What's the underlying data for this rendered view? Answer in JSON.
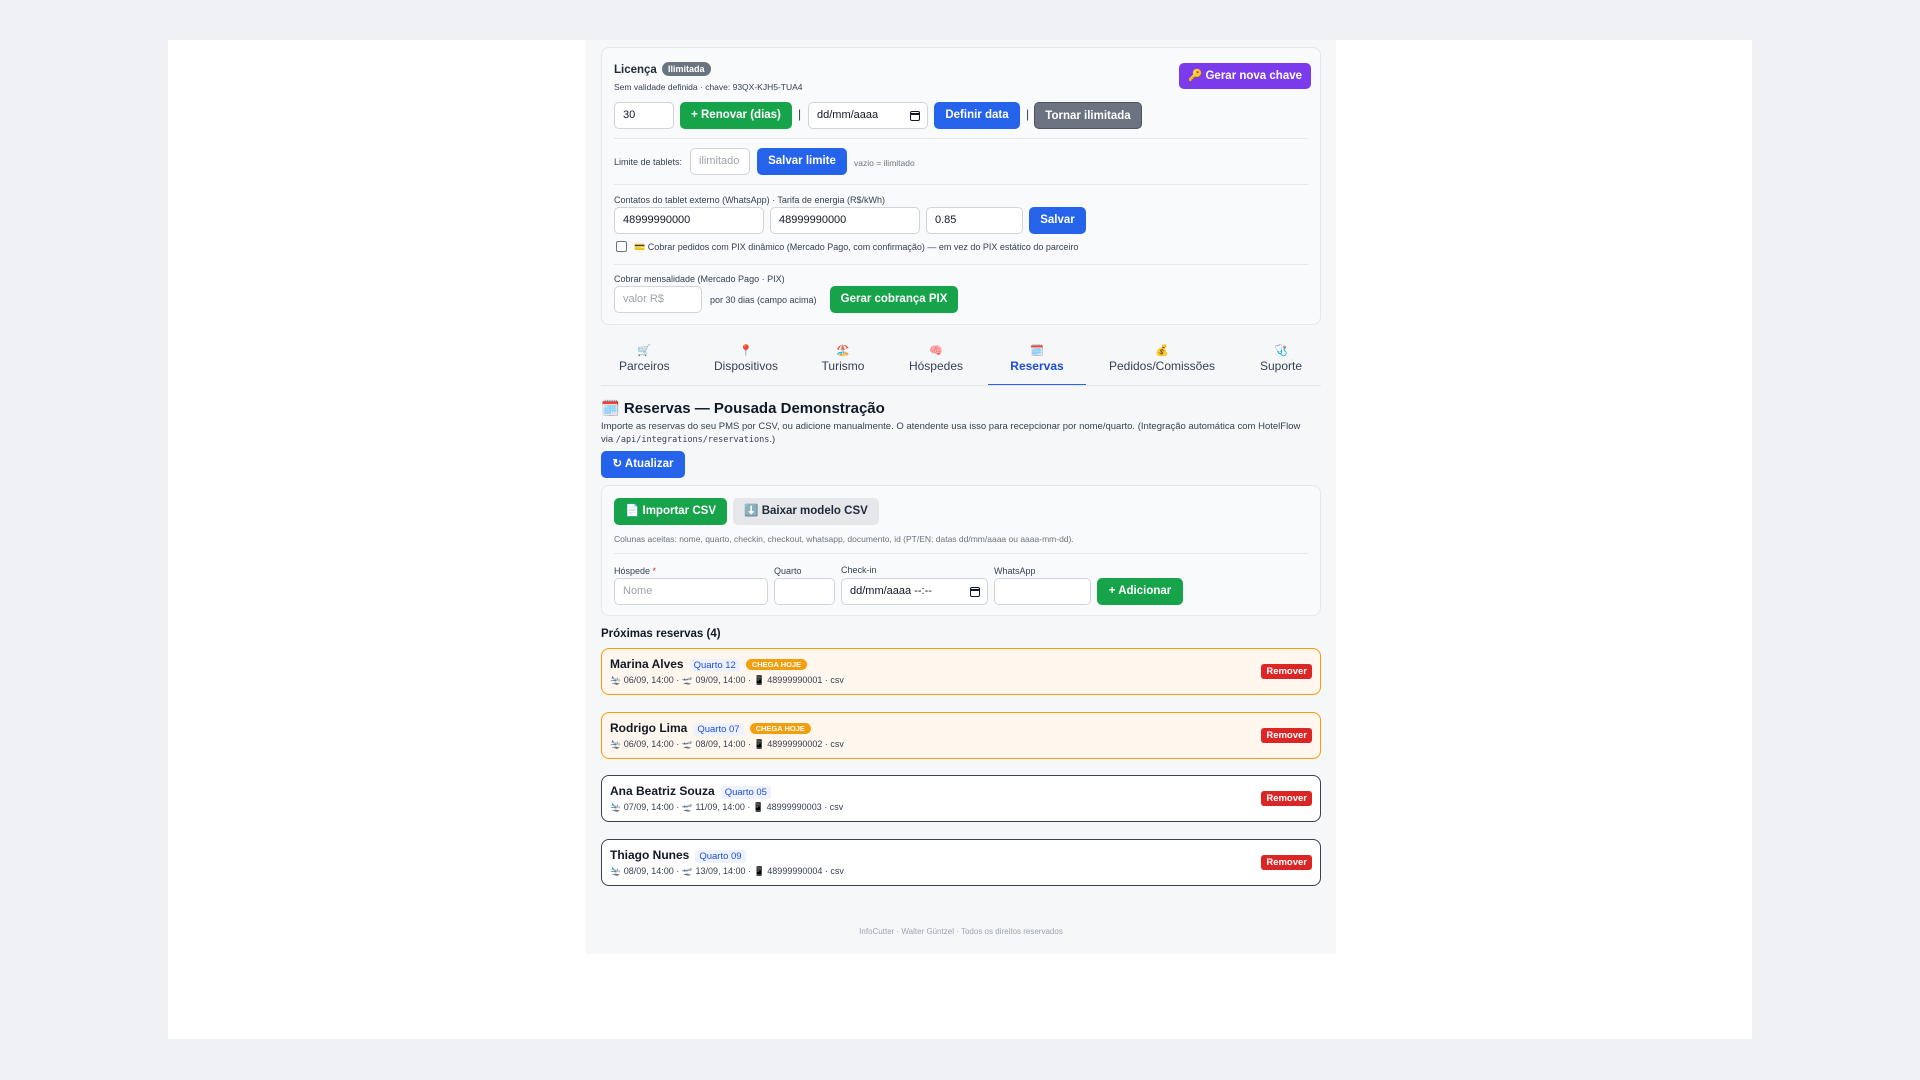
{
  "license": {
    "title": "Licença",
    "badge": "Ilimitada",
    "subtitle": "Sem validade definida · chave: 93QX-KJH5-TUA4",
    "generate_key": "🔑 Gerar nova chave",
    "days_value": "30",
    "renew_button": "+ Renovar (dias)",
    "date_placeholder": "dd/mm/aaaa",
    "set_date_button": "Definir data",
    "unlimited_button": "Tornar ilimitada",
    "separator": "|"
  },
  "tablets": {
    "label": "Limite de tablets:",
    "placeholder": "ilimitado",
    "save_button": "Salvar limite",
    "hint": "vazio = ilimitado"
  },
  "contacts": {
    "label": "Contatos do tablet externo (WhatsApp) · Tarifa de energia (R$/kWh)",
    "phone1": "48999990000",
    "phone2": "48999990000",
    "tariff": "0.85",
    "save_button": "Salvar",
    "pix_checkbox_label": "💳 Cobrar pedidos com PIX dinâmico (Mercado Pago, com confirmação) — em vez do PIX estático do parceiro"
  },
  "monthly": {
    "label": "Cobrar mensalidade (Mercado Pago · PIX)",
    "placeholder": "valor R$",
    "hint": "por 30 dias (campo acima)",
    "button": "Gerar cobrança PIX"
  },
  "tabs": [
    {
      "icon": "🛒",
      "label": "Parceiros"
    },
    {
      "icon": "📍",
      "label": "Dispositivos"
    },
    {
      "icon": "🏖️",
      "label": "Turismo"
    },
    {
      "icon": "🧠",
      "label": "Hóspedes"
    },
    {
      "icon": "🗓️",
      "label": "Reservas"
    },
    {
      "icon": "💰",
      "label": "Pedidos/Comissões"
    },
    {
      "icon": "🩺",
      "label": "Suporte"
    }
  ],
  "reservas": {
    "icon": "🗓️",
    "title": "Reservas — Pousada Demonstração",
    "description_1": "Importe as reservas do seu PMS por CSV, ou adicione manualmente. O atendente usa isso para recepcionar por nome/quarto. (Integração automática com HotelFlow",
    "description_2_prefix": "via",
    "description_2_code": "/api/integrations/reservations",
    "description_2_suffix": ".)",
    "refresh_button": "↻ Atualizar",
    "import_csv": "📄 Importar CSV",
    "download_csv": "⬇️ Baixar modelo CSV",
    "columns_hint": "Colunas aceitas: nome, quarto, checkin, checkout, whatsapp, documento, id (PT/EN; datas dd/mm/aaaa ou aaaa-mm-dd).",
    "form": {
      "guest_label": "Hóspede",
      "required_mark": "*",
      "guest_placeholder": "Nome",
      "room_label": "Quarto",
      "checkin_label": "Check-in",
      "checkin_placeholder": "dd/mm/aaaa --:--",
      "whatsapp_label": "WhatsApp",
      "add_button": "+ Adicionar"
    },
    "upcoming_title": "Próximas reservas (4)",
    "remove_label": "Remover",
    "today_badge": "CHEGA HOJE",
    "items": [
      {
        "name": "Marina Alves",
        "room": "Quarto 12",
        "today": true,
        "checkin": "06/09, 14:00",
        "checkout": "09/09, 14:00",
        "phone": "48999990001",
        "source": "csv"
      },
      {
        "name": "Rodrigo Lima",
        "room": "Quarto 07",
        "today": true,
        "checkin": "06/09, 14:00",
        "checkout": "08/09, 14:00",
        "phone": "48999990002",
        "source": "csv"
      },
      {
        "name": "Ana Beatriz Souza",
        "room": "Quarto 05",
        "today": false,
        "checkin": "07/09, 14:00",
        "checkout": "11/09, 14:00",
        "phone": "48999990003",
        "source": "csv"
      },
      {
        "name": "Thiago Nunes",
        "room": "Quarto 09",
        "today": false,
        "checkin": "08/09, 14:00",
        "checkout": "13/09, 14:00",
        "phone": "48999990004",
        "source": "csv"
      }
    ]
  },
  "footer": "InfoCutter · Walter Güntzel · Todos os direitos reservados",
  "colors": {
    "primary": "#2563eb",
    "success": "#16a34a",
    "danger": "#dc2626",
    "accent": "#7c3aed",
    "warning": "#f59e0b"
  }
}
